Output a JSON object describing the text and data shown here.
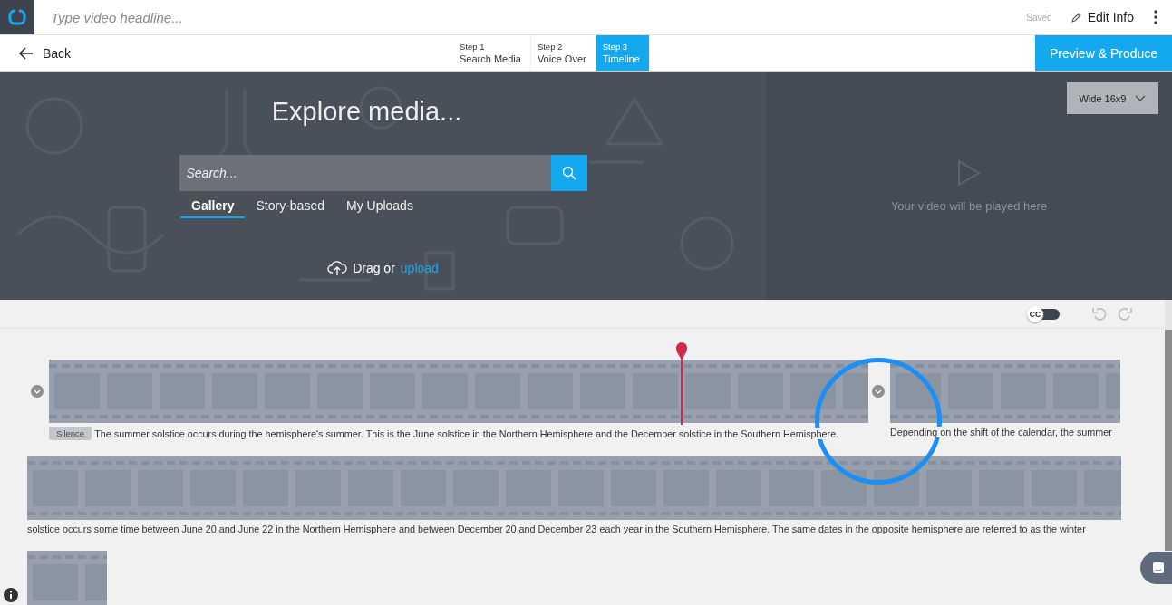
{
  "header": {
    "headline_placeholder": "Type video headline...",
    "save_status": "Saved",
    "edit_button": "Edit Info"
  },
  "nav": {
    "back": "Back",
    "steps": [
      {
        "number": "Step 1",
        "label": "Search Media",
        "selected": false
      },
      {
        "number": "Step 2",
        "label": "Voice Over",
        "selected": false
      },
      {
        "number": "Step 3",
        "label": "Timeline",
        "selected": true
      }
    ],
    "primary_button": "Preview & Produce"
  },
  "media": {
    "title": "Explore media...",
    "search_placeholder": "Search...",
    "tabs": [
      {
        "label": "Gallery",
        "selected": true
      },
      {
        "label": "Story-based",
        "selected": false
      },
      {
        "label": "My Uploads",
        "selected": false
      }
    ],
    "drag_text": "Drag or",
    "upload_link": "upload"
  },
  "preview": {
    "aspect": "Wide 16x9",
    "message": "Your video will be played here"
  },
  "toolbar": {
    "cc_label": "CC",
    "cc_on": false
  },
  "timeline": {
    "rows": [
      {
        "clips": [
          {
            "kind": "clip",
            "badge": "Silence",
            "caption": "The summer solstice occurs during the hemisphere's summer. This is the June solstice in the Northern Hemisphere and the December solstice in the Southern Hemisphere."
          },
          {
            "kind": "clip",
            "caption": "Depending on the shift of the calendar, the summer"
          }
        ]
      },
      {
        "clips": [
          {
            "kind": "clip",
            "caption": "solstice occurs some time between June 20 and June 22 in the Northern Hemisphere and between December 20 and December 23 each year in the Southern Hemisphere. The same dates in the opposite hemisphere are referred to as the winter"
          }
        ]
      },
      {
        "clips": [
          {
            "kind": "clip"
          }
        ]
      }
    ]
  }
}
